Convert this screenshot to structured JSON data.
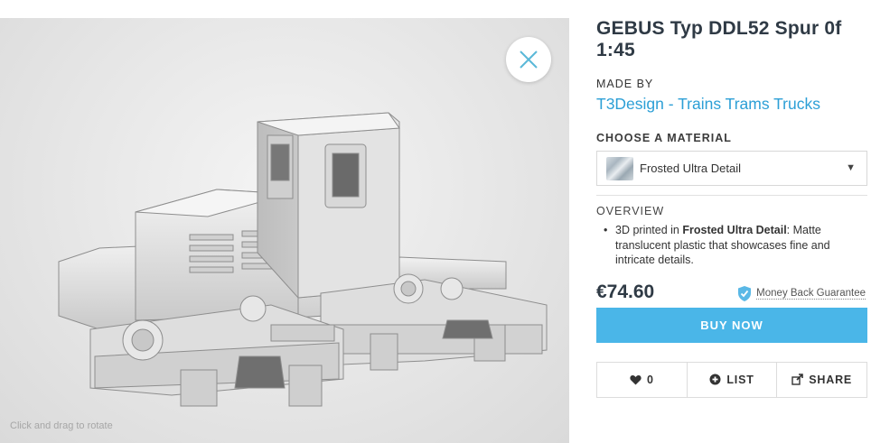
{
  "viewer": {
    "hint": "Click and drag to rotate"
  },
  "product": {
    "title": "GEBUS Typ DDL52 Spur 0f 1:45",
    "made_by_label": "MADE BY",
    "maker": "T3Design - Trains Trams Trucks"
  },
  "material": {
    "label": "CHOOSE A MATERIAL",
    "selected": "Frosted Ultra Detail"
  },
  "overview": {
    "label": "OVERVIEW",
    "prefix": "3D printed in ",
    "material_name": "Frosted Ultra Detail",
    "description": ": Matte translucent plastic that showcases fine and intricate details."
  },
  "purchase": {
    "price": "€74.60",
    "guarantee": "Money Back Guarantee",
    "buy_label": "BUY NOW"
  },
  "actions": {
    "like_count": "0",
    "list_label": "LIST",
    "share_label": "SHARE"
  },
  "colors": {
    "accent": "#4ab6e8",
    "link": "#2c9fd6",
    "close_icon": "#5ab8d8"
  },
  "icons": {
    "close": "close-icon",
    "heart": "heart-icon",
    "add": "plus-circle-icon",
    "share": "share-icon",
    "shield": "shield-check-icon",
    "caret": "caret-down-icon"
  }
}
